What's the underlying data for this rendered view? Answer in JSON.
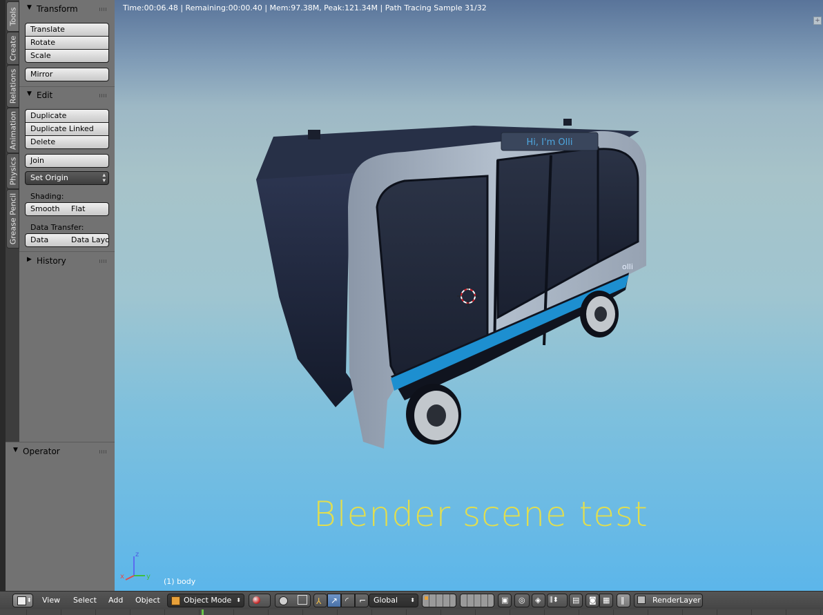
{
  "vertical_tabs": [
    "Tools",
    "Create",
    "Relations",
    "Animation",
    "Physics",
    "Grease Pencil"
  ],
  "toolshelf": {
    "transform": {
      "title": "Transform",
      "buttons": [
        "Translate",
        "Rotate",
        "Scale"
      ],
      "mirror": "Mirror"
    },
    "edit": {
      "title": "Edit",
      "buttons": [
        "Duplicate",
        "Duplicate Linked",
        "Delete"
      ],
      "join": "Join",
      "set_origin": "Set Origin",
      "shading_label": "Shading:",
      "smooth": "Smooth",
      "flat": "Flat",
      "data_transfer_label": "Data Transfer:",
      "data": "Data",
      "data_layout": "Data Layo"
    },
    "history": {
      "title": "History"
    }
  },
  "operator": {
    "title": "Operator"
  },
  "viewport": {
    "render_info": "Time:00:06.48 | Remaining:00:00.40 | Mem:97.38M, Peak:121.34M | Path Tracing Sample 31/32",
    "scene_text": "Blender scene test",
    "object_info": "(1) body",
    "bus_sign": "Hi, I'm Olli",
    "bus_logo": "olli",
    "axes": {
      "x": "x",
      "y": "y",
      "z": "z"
    }
  },
  "header": {
    "menus": [
      "View",
      "Select",
      "Add",
      "Object"
    ],
    "mode": "Object Mode",
    "orientation": "Global",
    "render_layer": "RenderLayer"
  },
  "colors": {
    "scene_text": "#e2de4e",
    "stripe": "#1d8fd0"
  }
}
